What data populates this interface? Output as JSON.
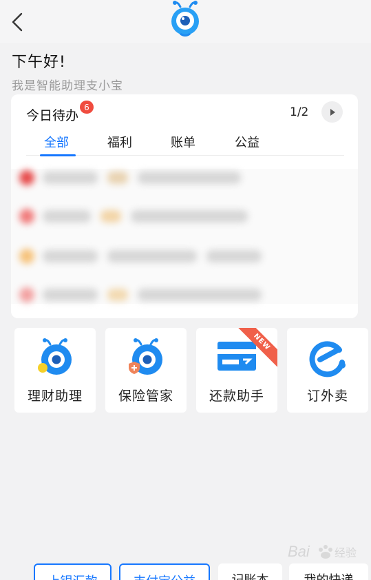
{
  "header": {
    "back_icon": "chevron-left-icon",
    "logo_icon": "mascot-logo"
  },
  "greeting": {
    "hello": "下午好!",
    "subtitle": "我是智能助理支小宝"
  },
  "todo": {
    "title": "今日待办",
    "badge": "6",
    "page": "1/2",
    "next_icon": "play-right-icon",
    "tabs": [
      {
        "label": "全部",
        "active": true
      },
      {
        "label": "福利",
        "active": false
      },
      {
        "label": "账单",
        "active": false
      },
      {
        "label": "公益",
        "active": false
      }
    ]
  },
  "services": [
    {
      "label": "理财助理",
      "icon": "mascot-finance-icon"
    },
    {
      "label": "保险管家",
      "icon": "mascot-insurance-icon"
    },
    {
      "label": "还款助手",
      "icon": "card-repay-icon",
      "ribbon": "NEW"
    },
    {
      "label": "订外卖",
      "icon": "eleme-icon"
    }
  ],
  "bottom_chips": [
    {
      "label": "上银汇款"
    },
    {
      "label": "支付宝公益"
    },
    {
      "label": "记账本"
    },
    {
      "label": "我的快递"
    }
  ],
  "watermark": {
    "text": "Bai 经验"
  },
  "colors": {
    "accent": "#1677ff",
    "badge": "#f04c3f",
    "background": "#f2f2f3"
  }
}
